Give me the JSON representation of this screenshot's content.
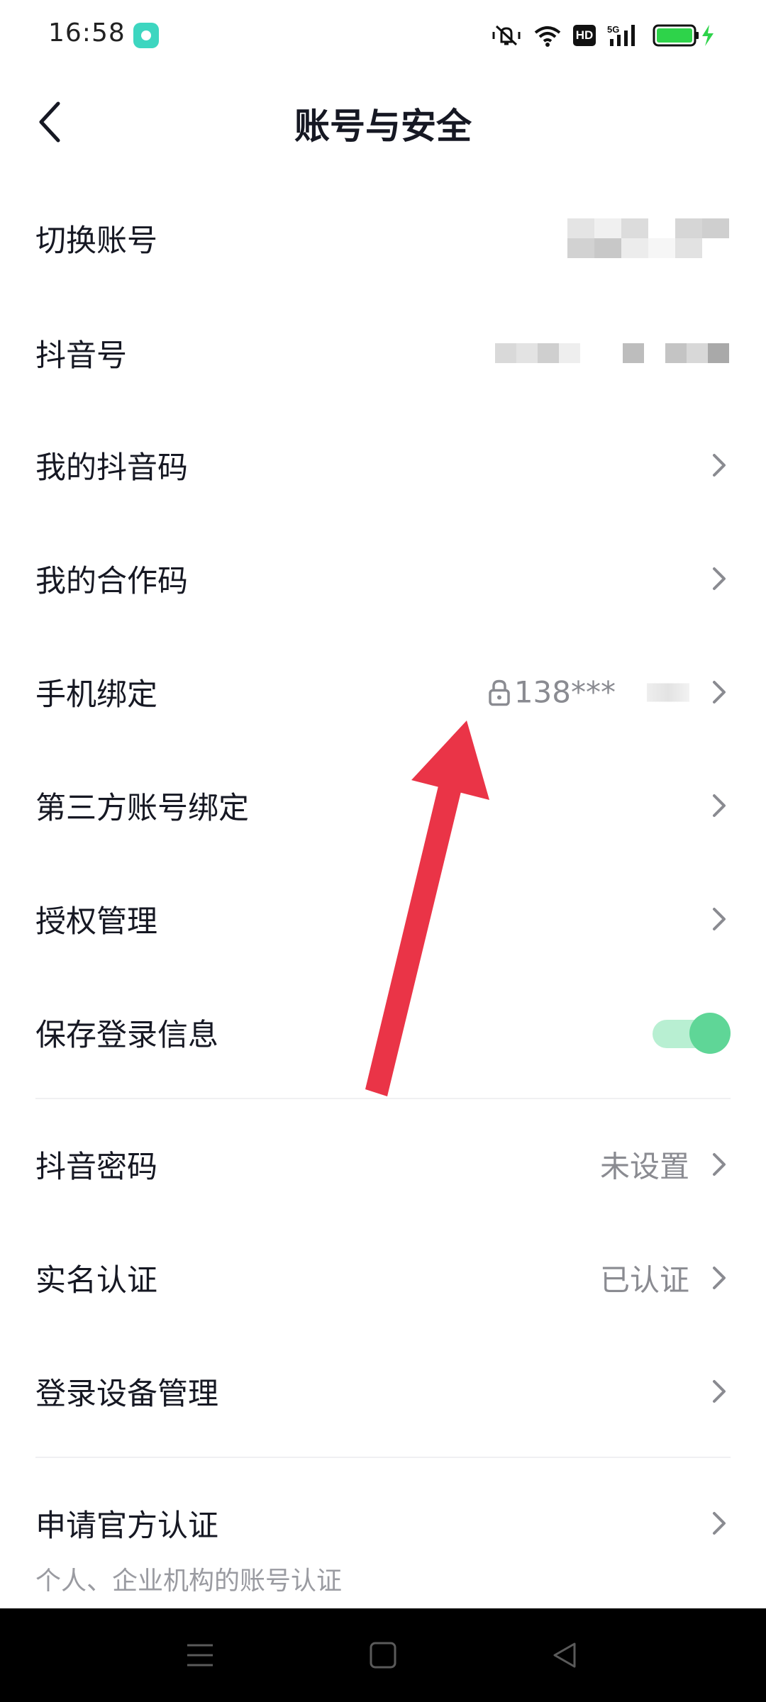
{
  "status_bar": {
    "time": "16:58",
    "hd_badge": "HD",
    "network_label": "5G",
    "icons": [
      "app-notification-icon",
      "mute-vibrate-icon",
      "wifi-icon",
      "hd-icon",
      "signal-5g-icon",
      "battery-charging-icon"
    ],
    "battery_color": "#2ed34a"
  },
  "header": {
    "title": "账号与安全",
    "back_icon": "chevron-left-icon"
  },
  "settings": {
    "switch_account": {
      "label": "切换账号"
    },
    "douyin_id": {
      "label": "抖音号"
    },
    "my_douyin_code": {
      "label": "我的抖音码"
    },
    "my_cooperation_code": {
      "label": "我的合作码"
    },
    "phone_binding": {
      "label": "手机绑定",
      "value": "138***",
      "icon": "lock-icon"
    },
    "third_party_binding": {
      "label": "第三方账号绑定"
    },
    "authorization_management": {
      "label": "授权管理"
    },
    "save_login_info": {
      "label": "保存登录信息",
      "toggle_on": true,
      "toggle_color": "#5fd697"
    },
    "douyin_password": {
      "label": "抖音密码",
      "value": "未设置"
    },
    "real_name_auth": {
      "label": "实名认证",
      "value": "已认证"
    },
    "login_device_management": {
      "label": "登录设备管理"
    },
    "official_verification": {
      "label": "申请官方认证",
      "sublabel": "个人、企业机构的账号认证"
    }
  },
  "annotation": {
    "arrow_color": "#ea3447",
    "points_to": "phone_binding"
  },
  "nav_bar": {
    "icons": [
      "menu-icon",
      "home-square-icon",
      "back-triangle-icon"
    ]
  }
}
